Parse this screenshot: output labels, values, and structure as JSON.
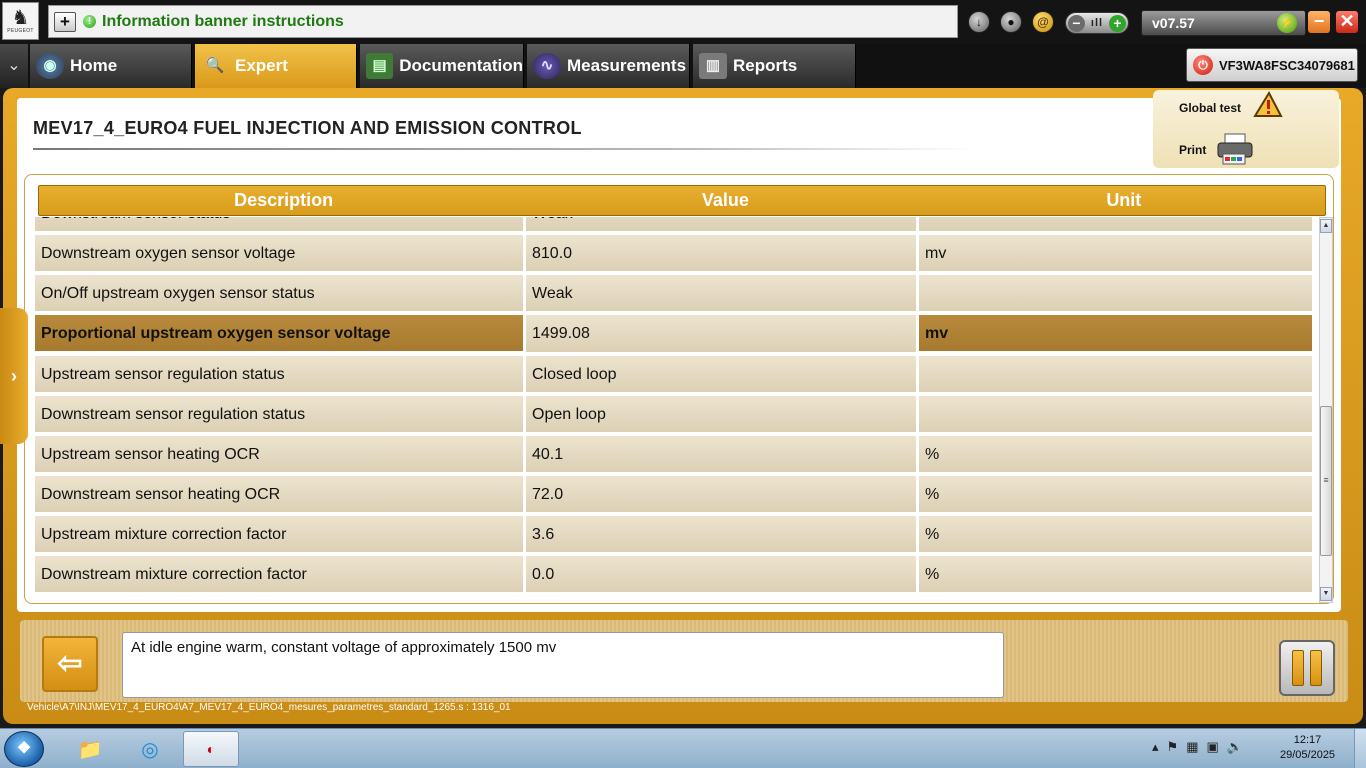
{
  "app": {
    "brand_logo_text": "PEUGEOT",
    "banner_text": "Information banner instructions",
    "version": "v07.57",
    "vin": "VF3WA8FSC34079681"
  },
  "nav": {
    "tabs": [
      {
        "label": "Home",
        "icon": "home-icon",
        "active": false
      },
      {
        "label": "Expert",
        "icon": "magnifier-icon",
        "active": true
      },
      {
        "label": "Documentation",
        "icon": "book-icon",
        "active": false
      },
      {
        "label": "Measurements",
        "icon": "waveform-icon",
        "active": false
      },
      {
        "label": "Reports",
        "icon": "report-icon",
        "active": false
      }
    ]
  },
  "page": {
    "title": "MEV17_4_EURO4  FUEL INJECTION AND EMISSION CONTROL",
    "global_test_label": "Global test",
    "print_label": "Print"
  },
  "table": {
    "headers": {
      "description": "Description",
      "value": "Value",
      "unit": "Unit"
    },
    "rows": [
      {
        "description": "Downstream sensor status",
        "value": "Weak",
        "unit": ""
      },
      {
        "description": "Downstream oxygen sensor voltage",
        "value": "810.0",
        "unit": "mv"
      },
      {
        "description": "On/Off upstream oxygen sensor status",
        "value": "Weak",
        "unit": ""
      },
      {
        "description": "Proportional upstream oxygen sensor voltage",
        "value": "1499.08",
        "unit": "mv",
        "selected": true
      },
      {
        "description": "Upstream sensor regulation status",
        "value": "Closed loop",
        "unit": ""
      },
      {
        "description": "Downstream sensor regulation status",
        "value": "Open loop",
        "unit": ""
      },
      {
        "description": "Upstream sensor heating OCR",
        "value": "40.1",
        "unit": "%"
      },
      {
        "description": "Downstream sensor heating OCR",
        "value": "72.0",
        "unit": "%"
      },
      {
        "description": "Upstream mixture correction factor",
        "value": "3.6",
        "unit": "%"
      },
      {
        "description": "Downstream mixture correction factor",
        "value": "0.0",
        "unit": "%"
      }
    ]
  },
  "info": {
    "message": "At idle engine warm, constant voltage of approximately 1500 mv",
    "path": "Vehicle\\A7\\INJ\\MEV17_4_EURO4\\A7_MEV17_4_EURO4_mesures_parametres_standard_1265.s : 1316_01"
  },
  "taskbar": {
    "time": "12:17",
    "date": "29/05/2025"
  },
  "colors": {
    "accent": "#e0a424",
    "selected_row": "#a97c31",
    "row_bg": "#e3d9c0",
    "banner_text": "#1f7a12"
  }
}
